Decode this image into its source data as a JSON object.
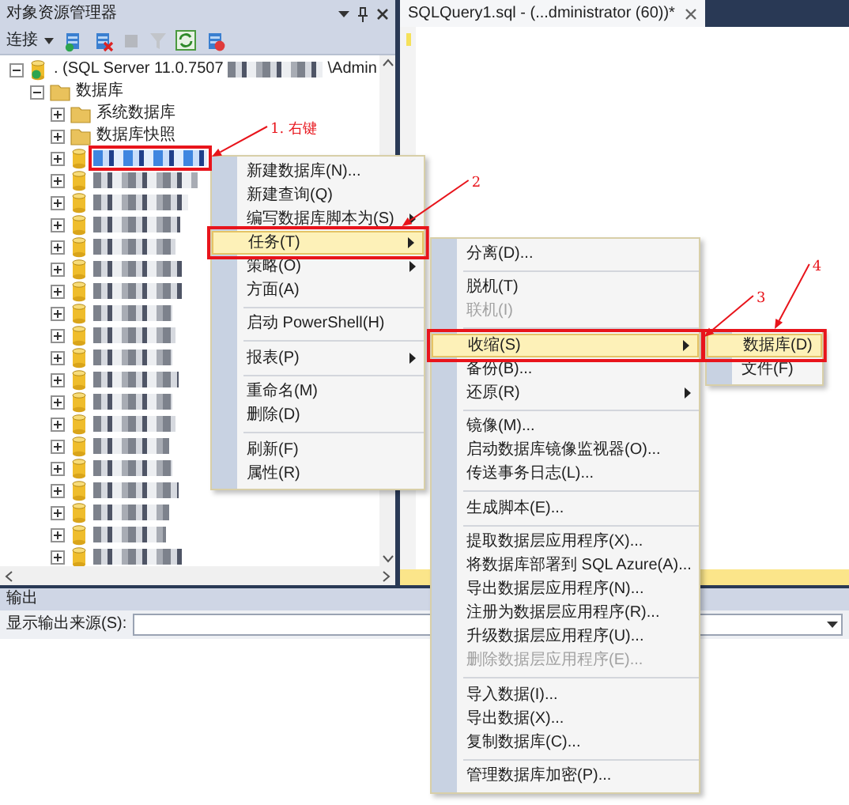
{
  "object_explorer": {
    "title": "对象资源管理器",
    "toolbar": {
      "connect_label": "连接"
    },
    "tree": [
      {
        "kind": "server",
        "label": ". (SQL Server 11.0.7507",
        "label_end": "\\Admin",
        "expanded": true,
        "selected": false,
        "children": [
          {
            "kind": "folder",
            "label": "数据库",
            "expanded": true,
            "selected": false,
            "children": [
              {
                "kind": "folder",
                "label": "系统数据库",
                "expanded": false,
                "selected": false
              },
              {
                "kind": "folder",
                "label": "数据库快照",
                "expanded": false,
                "selected": false
              },
              {
                "kind": "database",
                "expanded": false,
                "selected": true
              },
              {
                "kind": "database",
                "expanded": false,
                "selected": false
              },
              {
                "kind": "database",
                "expanded": false,
                "selected": false
              },
              {
                "kind": "database",
                "expanded": false,
                "selected": false
              },
              {
                "kind": "database",
                "expanded": false,
                "selected": false
              },
              {
                "kind": "database",
                "expanded": false,
                "selected": false
              },
              {
                "kind": "database",
                "expanded": false,
                "selected": false
              },
              {
                "kind": "database",
                "expanded": false,
                "selected": false
              },
              {
                "kind": "database",
                "expanded": false,
                "selected": false
              },
              {
                "kind": "database",
                "expanded": false,
                "selected": false
              },
              {
                "kind": "database",
                "expanded": false,
                "selected": false
              },
              {
                "kind": "database",
                "expanded": false,
                "selected": false
              },
              {
                "kind": "database",
                "expanded": false,
                "selected": false
              },
              {
                "kind": "database",
                "expanded": false,
                "selected": false
              },
              {
                "kind": "database",
                "expanded": false,
                "selected": false
              },
              {
                "kind": "database",
                "expanded": false,
                "selected": false
              },
              {
                "kind": "database",
                "expanded": false,
                "selected": false
              },
              {
                "kind": "database",
                "expanded": false,
                "selected": false
              },
              {
                "kind": "database",
                "expanded": false,
                "selected": false
              }
            ]
          }
        ]
      }
    ]
  },
  "editor": {
    "tab_title": "SQLQuery1.sql - (...dministrator (60))*"
  },
  "context_menus": [
    {
      "items": [
        {
          "kind": "item",
          "label": "新建数据库(N)...",
          "submenu": false,
          "selected": false,
          "disabled": false
        },
        {
          "kind": "item",
          "label": "新建查询(Q)",
          "submenu": false,
          "selected": false,
          "disabled": false
        },
        {
          "kind": "item",
          "label": "编写数据库脚本为(S)",
          "submenu": true,
          "selected": false,
          "disabled": false
        },
        {
          "kind": "item",
          "label": "任务(T)",
          "submenu": true,
          "selected": true,
          "disabled": false
        },
        {
          "kind": "item",
          "label": "策略(O)",
          "submenu": true,
          "selected": false,
          "disabled": false
        },
        {
          "kind": "item",
          "label": "方面(A)",
          "submenu": false,
          "selected": false,
          "disabled": false
        },
        {
          "kind": "separator"
        },
        {
          "kind": "item",
          "label": "启动 PowerShell(H)",
          "submenu": false,
          "selected": false,
          "disabled": false
        },
        {
          "kind": "separator"
        },
        {
          "kind": "item",
          "label": "报表(P)",
          "submenu": true,
          "selected": false,
          "disabled": false
        },
        {
          "kind": "separator"
        },
        {
          "kind": "item",
          "label": "重命名(M)",
          "submenu": false,
          "selected": false,
          "disabled": false
        },
        {
          "kind": "item",
          "label": "删除(D)",
          "submenu": false,
          "selected": false,
          "disabled": false
        },
        {
          "kind": "separator"
        },
        {
          "kind": "item",
          "label": "刷新(F)",
          "submenu": false,
          "selected": false,
          "disabled": false
        },
        {
          "kind": "item",
          "label": "属性(R)",
          "submenu": false,
          "selected": false,
          "disabled": false
        }
      ]
    },
    {
      "items": [
        {
          "kind": "item",
          "label": "分离(D)...",
          "submenu": false,
          "selected": false,
          "disabled": false
        },
        {
          "kind": "separator"
        },
        {
          "kind": "item",
          "label": "脱机(T)",
          "submenu": false,
          "selected": false,
          "disabled": false
        },
        {
          "kind": "item",
          "label": "联机(I)",
          "submenu": false,
          "selected": false,
          "disabled": true
        },
        {
          "kind": "separator"
        },
        {
          "kind": "item",
          "label": "收缩(S)",
          "submenu": true,
          "selected": true,
          "disabled": false
        },
        {
          "kind": "item",
          "label": "备份(B)...",
          "submenu": false,
          "selected": false,
          "disabled": false
        },
        {
          "kind": "item",
          "label": "还原(R)",
          "submenu": true,
          "selected": false,
          "disabled": false
        },
        {
          "kind": "separator"
        },
        {
          "kind": "item",
          "label": "镜像(M)...",
          "submenu": false,
          "selected": false,
          "disabled": false
        },
        {
          "kind": "item",
          "label": "启动数据库镜像监视器(O)...",
          "submenu": false,
          "selected": false,
          "disabled": false
        },
        {
          "kind": "item",
          "label": "传送事务日志(L)...",
          "submenu": false,
          "selected": false,
          "disabled": false
        },
        {
          "kind": "separator"
        },
        {
          "kind": "item",
          "label": "生成脚本(E)...",
          "submenu": false,
          "selected": false,
          "disabled": false
        },
        {
          "kind": "separator"
        },
        {
          "kind": "item",
          "label": "提取数据层应用程序(X)...",
          "submenu": false,
          "selected": false,
          "disabled": false
        },
        {
          "kind": "item",
          "label": "将数据库部署到 SQL Azure(A)...",
          "submenu": false,
          "selected": false,
          "disabled": false
        },
        {
          "kind": "item",
          "label": "导出数据层应用程序(N)...",
          "submenu": false,
          "selected": false,
          "disabled": false
        },
        {
          "kind": "item",
          "label": "注册为数据层应用程序(R)...",
          "submenu": false,
          "selected": false,
          "disabled": false
        },
        {
          "kind": "item",
          "label": "升级数据层应用程序(U)...",
          "submenu": false,
          "selected": false,
          "disabled": false
        },
        {
          "kind": "item",
          "label": "删除数据层应用程序(E)...",
          "submenu": false,
          "selected": false,
          "disabled": true
        },
        {
          "kind": "separator"
        },
        {
          "kind": "item",
          "label": "导入数据(I)...",
          "submenu": false,
          "selected": false,
          "disabled": false
        },
        {
          "kind": "item",
          "label": "导出数据(X)...",
          "submenu": false,
          "selected": false,
          "disabled": false
        },
        {
          "kind": "item",
          "label": "复制数据库(C)...",
          "submenu": false,
          "selected": false,
          "disabled": false
        },
        {
          "kind": "separator"
        },
        {
          "kind": "item",
          "label": "管理数据库加密(P)...",
          "submenu": false,
          "selected": false,
          "disabled": false
        }
      ]
    },
    {
      "items": [
        {
          "kind": "item",
          "label": "数据库(D)",
          "submenu": false,
          "selected": true,
          "disabled": false
        },
        {
          "kind": "item",
          "label": "文件(F)",
          "submenu": false,
          "selected": false,
          "disabled": false
        }
      ]
    }
  ],
  "annotations": [
    {
      "label": "1. 右键"
    },
    {
      "label": "2"
    },
    {
      "label": "3"
    },
    {
      "label": "4"
    }
  ],
  "output": {
    "title": "输出",
    "source_label": "显示输出来源(S):"
  }
}
